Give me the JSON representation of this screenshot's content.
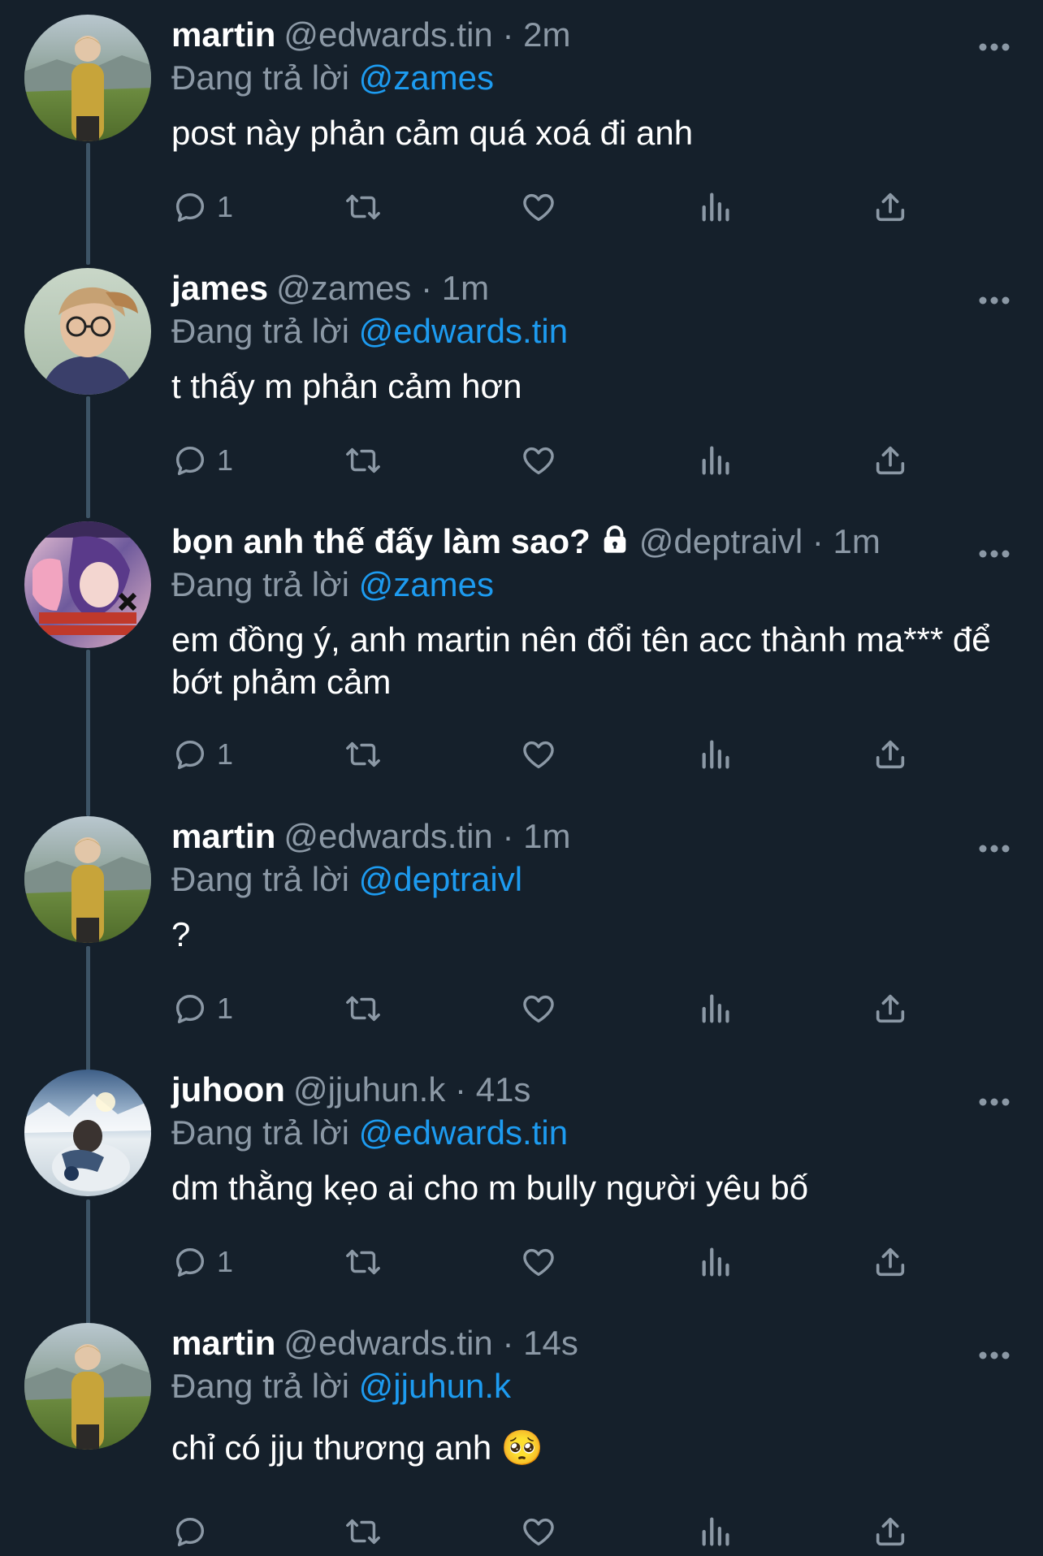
{
  "tweets": [
    {
      "name": "martin",
      "handle": "@edwards.tin",
      "sep": "·",
      "time": "2m",
      "reply_prefix": "Đang trả lời",
      "reply_to": "@zames",
      "text": "post này phản cảm quá xoá đi anh",
      "reply_count": "1",
      "avatar": "landscape-boy-yellow-jacket"
    },
    {
      "name": "james",
      "handle": "@zames",
      "sep": "·",
      "time": "1m",
      "reply_prefix": "Đang trả lời",
      "reply_to": "@edwards.tin",
      "text": "t thấy m phản cảm hơn",
      "reply_count": "1",
      "avatar": "boy-glasses-cap"
    },
    {
      "name": "bọn anh thế đấy làm sao?",
      "handle": "@deptraivl",
      "sep": "·",
      "time": "1m",
      "reply_prefix": "Đang trả lời",
      "reply_to": "@zames",
      "text": "em đồng ý, anh martin nên đổi tên acc thành ma*** để bớt phảm cảm",
      "reply_count": "1",
      "avatar": "anime-meme",
      "locked": true
    },
    {
      "name": "martin",
      "handle": "@edwards.tin",
      "sep": "·",
      "time": "1m",
      "reply_prefix": "Đang trả lời",
      "reply_to": "@deptraivl",
      "text": "?",
      "reply_count": "1",
      "avatar": "landscape-boy-yellow-jacket"
    },
    {
      "name": "juhoon",
      "handle": "@jjuhun.k",
      "sep": "·",
      "time": "41s",
      "reply_prefix": "Đang trả lời",
      "reply_to": "@edwards.tin",
      "text": "dm thằng kẹo ai cho m bully người yêu bố",
      "reply_count": "1",
      "avatar": "snow-mountain-person"
    },
    {
      "name": "martin",
      "handle": "@edwards.tin",
      "sep": "·",
      "time": "14s",
      "reply_prefix": "Đang trả lời",
      "reply_to": "@jjuhun.k",
      "text": "chỉ có jju thương anh 🥺",
      "reply_count": "",
      "avatar": "landscape-boy-yellow-jacket"
    }
  ],
  "icons": {
    "reply": "reply-icon",
    "retweet": "retweet-icon",
    "like": "heart-icon",
    "views": "views-icon",
    "share": "share-icon",
    "more": "more-icon",
    "lock": "lock-icon"
  },
  "colors": {
    "background": "#15202b",
    "name": "#ffffff",
    "secondary": "#8b98a5",
    "mention": "#1d9bf0",
    "thread_line": "#3d5466"
  }
}
